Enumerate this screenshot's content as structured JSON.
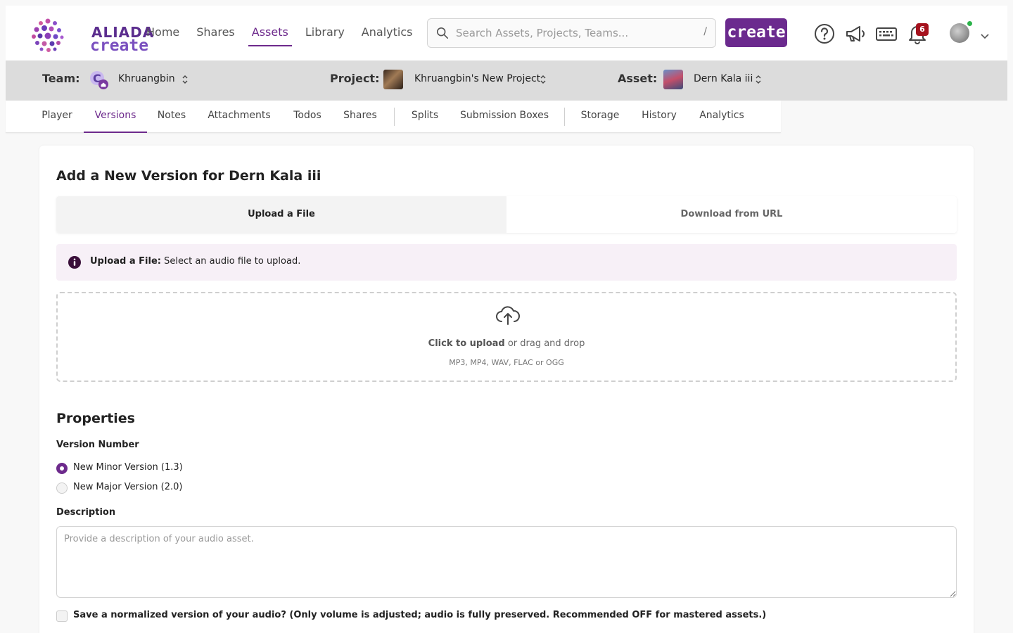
{
  "brand": {
    "line1": "ALIADA",
    "line2": "create",
    "color": "#6b2a8e"
  },
  "nav": {
    "items": [
      {
        "label": "Home",
        "active": false
      },
      {
        "label": "Shares",
        "active": false
      },
      {
        "label": "Assets",
        "active": true
      },
      {
        "label": "Library",
        "active": false
      },
      {
        "label": "Analytics",
        "active": false
      }
    ]
  },
  "search": {
    "placeholder": "Search Assets, Projects, Teams...",
    "shortcut": "/"
  },
  "header": {
    "create_label": "create",
    "notification_count": "6"
  },
  "context": {
    "team_label": "Team:",
    "team_value": "Khruangbin",
    "project_label": "Project:",
    "project_value": "Khruangbin's New Project",
    "asset_label": "Asset:",
    "asset_value": "Dern Kala iii"
  },
  "tabs": [
    {
      "label": "Player"
    },
    {
      "label": "Versions"
    },
    {
      "label": "Notes"
    },
    {
      "label": "Attachments"
    },
    {
      "label": "Todos"
    },
    {
      "label": "Shares"
    },
    {
      "label": "Splits"
    },
    {
      "label": "Submission Boxes"
    },
    {
      "label": "Storage"
    },
    {
      "label": "History"
    },
    {
      "label": "Analytics"
    }
  ],
  "form": {
    "title": "Add a New Version for Dern Kala iii",
    "seg_upload": "Upload a File",
    "seg_url": "Download from URL",
    "info_bold": "Upload a File:",
    "info_text": " Select an audio file to upload.",
    "drop_bold": "Click to upload",
    "drop_text": " or drag and drop",
    "drop_formats": "MP3, MP4, WAV, FLAC or OGG",
    "properties_heading": "Properties",
    "version_label": "Version Number",
    "minor_option": "New Minor Version (1.3)",
    "major_option": "New Major Version (2.0)",
    "selected_version": "minor",
    "description_label": "Description",
    "description_placeholder": "Provide a description of your audio asset.",
    "normalize_label": "Save a normalized version of your audio? (Only volume is adjusted; audio is fully preserved. Recommended OFF for mastered assets.)",
    "normalize_checked": false
  }
}
